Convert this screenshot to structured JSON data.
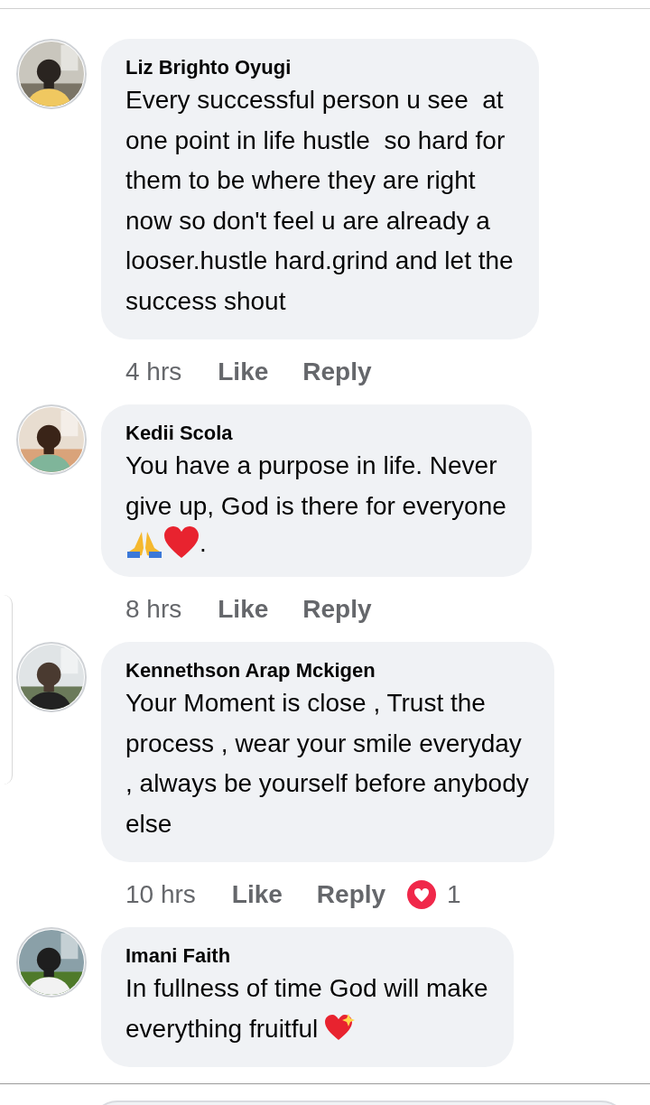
{
  "comments": [
    {
      "author": "Liz Brighto Oyugi",
      "lines": [
        "Every successful person u see  at",
        "one point in life hustle  so hard for",
        "them to be where they are right",
        "now so don't feel u are already a",
        "looser.hustle hard.grind and let the",
        "success shout"
      ],
      "time": "4 hrs",
      "like": "Like",
      "reply": "Reply"
    },
    {
      "author": "Kedii Scola",
      "lines": [
        "You have a purpose in life. Never",
        "give up, God is there for everyone"
      ],
      "emoji_line": ".",
      "time": "8 hrs",
      "like": "Like",
      "reply": "Reply"
    },
    {
      "author": "Kennethson Arap Mckigen",
      "lines": [
        "Your Moment is close , Trust the",
        "process , wear your smile everyday",
        ", always be yourself before anybody",
        "else"
      ],
      "time": "10 hrs",
      "like": "Like",
      "reply": "Reply",
      "reactions": "1"
    },
    {
      "author": "Imani Faith",
      "lines": [
        "In fullness of time God will make",
        "everything fruitful"
      ],
      "trailing_heart": true
    }
  ]
}
